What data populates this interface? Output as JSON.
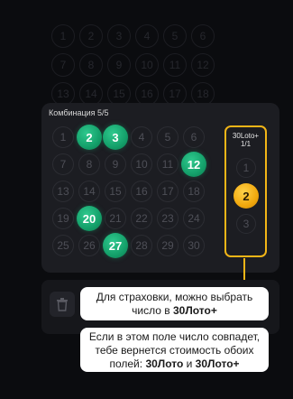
{
  "background_numbers": [
    "1",
    "2",
    "3",
    "4",
    "5",
    "6",
    "7",
    "8",
    "9",
    "10",
    "11",
    "12",
    "13",
    "14",
    "15",
    "16",
    "17",
    "18"
  ],
  "combination": {
    "label": "Комбинация 5/5"
  },
  "grid": {
    "numbers": [
      {
        "n": "1",
        "selected": false
      },
      {
        "n": "2",
        "selected": true
      },
      {
        "n": "3",
        "selected": true
      },
      {
        "n": "4",
        "selected": false
      },
      {
        "n": "5",
        "selected": false
      },
      {
        "n": "6",
        "selected": false
      },
      {
        "n": "7",
        "selected": false
      },
      {
        "n": "8",
        "selected": false
      },
      {
        "n": "9",
        "selected": false
      },
      {
        "n": "10",
        "selected": false
      },
      {
        "n": "11",
        "selected": false
      },
      {
        "n": "12",
        "selected": true
      },
      {
        "n": "13",
        "selected": false
      },
      {
        "n": "14",
        "selected": false
      },
      {
        "n": "15",
        "selected": false
      },
      {
        "n": "16",
        "selected": false
      },
      {
        "n": "17",
        "selected": false
      },
      {
        "n": "18",
        "selected": false
      },
      {
        "n": "19",
        "selected": false
      },
      {
        "n": "20",
        "selected": true
      },
      {
        "n": "21",
        "selected": false
      },
      {
        "n": "22",
        "selected": false
      },
      {
        "n": "23",
        "selected": false
      },
      {
        "n": "24",
        "selected": false
      },
      {
        "n": "25",
        "selected": false
      },
      {
        "n": "26",
        "selected": false
      },
      {
        "n": "27",
        "selected": true
      },
      {
        "n": "28",
        "selected": false
      },
      {
        "n": "29",
        "selected": false
      },
      {
        "n": "30",
        "selected": false
      }
    ]
  },
  "extra_field": {
    "title": "30Loto+",
    "count": "1/1",
    "numbers": [
      {
        "n": "1",
        "selected": false
      },
      {
        "n": "2",
        "selected": true
      },
      {
        "n": "3",
        "selected": false
      }
    ]
  },
  "tips": {
    "insurance_pre": "Для страховки, можно выбрать число в ",
    "insurance_bold": "30Лото+",
    "refund_pre": "Если в этом поле число совпадет, тебе вернется стоимость обоих полей: ",
    "refund_bold1": "30Лото",
    "refund_mid": " и ",
    "refund_bold2": "30Лото+"
  },
  "colors": {
    "accent_green": "#14a06a",
    "accent_gold": "#f2b517",
    "card": "#1c1d22"
  },
  "icons": {
    "trash": "trash-icon"
  }
}
